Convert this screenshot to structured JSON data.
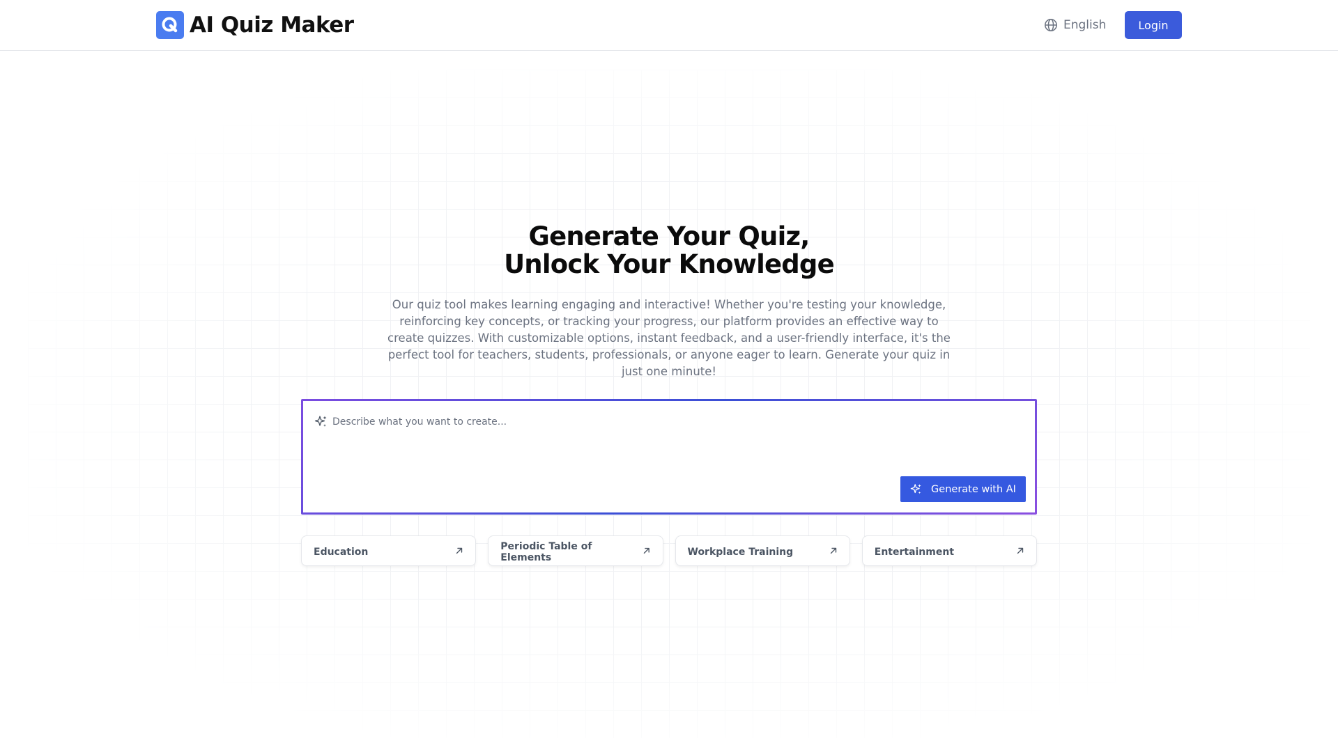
{
  "header": {
    "brand_name": "AI Quiz Maker",
    "logo_icon": "q-logo-icon",
    "language": "English",
    "login_label": "Login"
  },
  "hero": {
    "title_line1": "Generate Your Quiz,",
    "title_line2": "Unlock Your Knowledge",
    "description": "Our quiz tool makes learning engaging and interactive! Whether you're testing your knowledge, reinforcing key concepts, or tracking your progress, our platform provides an effective way to create quizzes. With customizable options, instant feedback, and a user-friendly interface, it's the perfect tool for teachers, students, professionals, or anyone eager to learn. Generate your quiz in just one minute!"
  },
  "prompt": {
    "placeholder": "Describe what you want to create...",
    "value": "",
    "generate_label": "Generate with AI"
  },
  "categories": [
    {
      "label": "Education"
    },
    {
      "label": "Periodic Table of Elements"
    },
    {
      "label": "Workplace Training"
    },
    {
      "label": "Entertainment"
    }
  ],
  "colors": {
    "accent": "#3b5bdb",
    "logo_bg": "#4a7cf0",
    "prompt_border_start": "#7b4ce0",
    "prompt_border_end": "#3b4fd6"
  }
}
